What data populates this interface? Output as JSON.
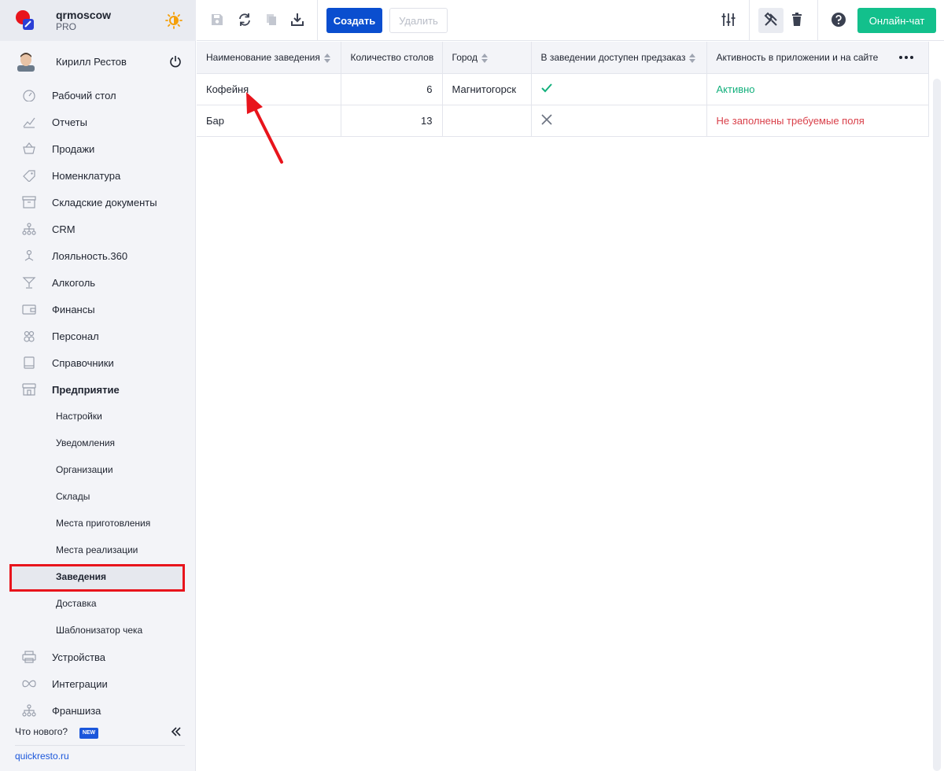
{
  "brand": {
    "name": "qrmoscow",
    "plan": "PRO"
  },
  "user": {
    "name": "Кирилл Рестов"
  },
  "nav": [
    {
      "label": "Рабочий стол",
      "icon": "dashboard-icon"
    },
    {
      "label": "Отчеты",
      "icon": "chart-icon"
    },
    {
      "label": "Продажи",
      "icon": "basket-icon"
    },
    {
      "label": "Номенклатура",
      "icon": "tag-icon"
    },
    {
      "label": "Складские документы",
      "icon": "archive-icon"
    },
    {
      "label": "CRM",
      "icon": "hierarchy-icon"
    },
    {
      "label": "Лояльность.360",
      "icon": "loyalty-icon"
    },
    {
      "label": "Алкоголь",
      "icon": "cocktail-icon"
    },
    {
      "label": "Финансы",
      "icon": "wallet-icon"
    },
    {
      "label": "Персонал",
      "icon": "people-icon"
    },
    {
      "label": "Справочники",
      "icon": "book-icon"
    },
    {
      "label": "Предприятие",
      "icon": "store-icon"
    }
  ],
  "subnav": [
    {
      "label": "Настройки"
    },
    {
      "label": "Уведомления"
    },
    {
      "label": "Организации"
    },
    {
      "label": "Склады"
    },
    {
      "label": "Места приготовления"
    },
    {
      "label": "Места реализации"
    },
    {
      "label": "Заведения"
    },
    {
      "label": "Доставка"
    },
    {
      "label": "Шаблонизатор чека"
    }
  ],
  "nav_bottom": [
    {
      "label": "Устройства",
      "icon": "printer-icon"
    },
    {
      "label": "Интеграции",
      "icon": "infinity-icon"
    },
    {
      "label": "Франшиза",
      "icon": "hierarchy-icon"
    }
  ],
  "footer": {
    "whats_new": "Что нового?",
    "badge": "NEW",
    "site": "quickresto.ru"
  },
  "toolbar": {
    "create_label": "Создать",
    "delete_label": "Удалить",
    "chat_label": "Онлайн-чат"
  },
  "table": {
    "headers": [
      "Наименование заведения",
      "Количество столов",
      "Город",
      "В заведении доступен предзаказ",
      "Активность в приложении и на сайте"
    ],
    "rows": [
      {
        "name": "Кофейня",
        "tables": "6",
        "city": "Магнитогорск",
        "preorder": true,
        "status": "Активно",
        "status_ok": true
      },
      {
        "name": "Бар",
        "tables": "13",
        "city": "",
        "preorder": false,
        "status": "Не заполнены требуемые поля",
        "status_ok": false
      }
    ]
  },
  "colors": {
    "primary": "#0a4ecf",
    "success": "#13c08c",
    "error": "#d9404a",
    "highlight": "#e8141c"
  }
}
